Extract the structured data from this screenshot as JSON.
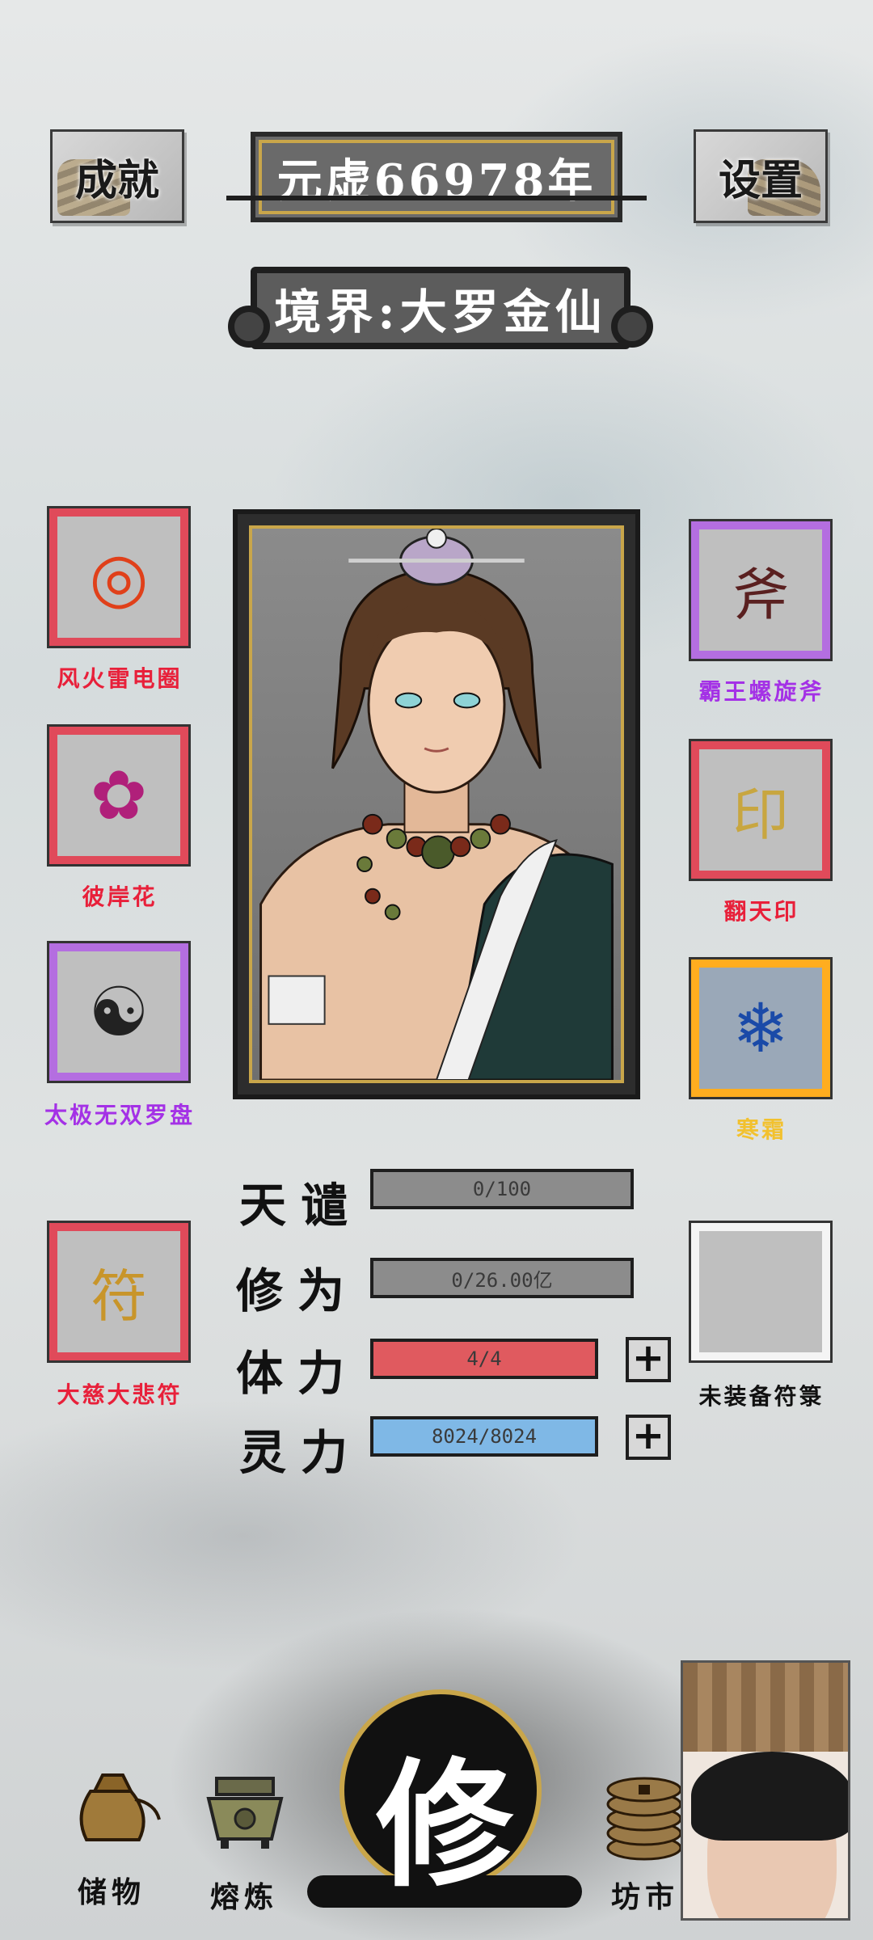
{
  "header": {
    "achievements_label": "成就",
    "year_label": "元虚66978年",
    "settings_label": "设置",
    "realm_label": "境界:大罗金仙"
  },
  "equipment": {
    "left": [
      {
        "name": "风火雷电圈",
        "rarity_color": "#e04a5a",
        "label_color": "#e8203a",
        "icon": "fire-ring-icon",
        "glyph": "◎"
      },
      {
        "name": "彼岸花",
        "rarity_color": "#e04a5a",
        "label_color": "#e8203a",
        "icon": "spider-lily-icon",
        "glyph": "✿"
      },
      {
        "name": "太极无双罗盘",
        "rarity_color": "#b46ee0",
        "label_color": "#a431e6",
        "icon": "bagua-compass-icon",
        "glyph": "☯"
      },
      {
        "name": "大慈大悲符",
        "rarity_color": "#e04a5a",
        "label_color": "#e8203a",
        "icon": "talisman-icon",
        "glyph": "符"
      }
    ],
    "right": [
      {
        "name": "霸王螺旋斧",
        "rarity_color": "#b46ee0",
        "label_color": "#a431e6",
        "icon": "axe-icon",
        "glyph": "斧"
      },
      {
        "name": "翻天印",
        "rarity_color": "#e04a5a",
        "label_color": "#e8203a",
        "icon": "dragon-seal-icon",
        "glyph": "印"
      },
      {
        "name": "寒霜",
        "rarity_color": "#ffad1f",
        "label_color": "#f2c12e",
        "icon": "frost-orb-icon",
        "glyph": "❄"
      },
      {
        "name": "未装备符箓",
        "rarity_color": "#f4f4f4",
        "label_color": "#111111",
        "icon": "empty-slot-icon",
        "glyph": ""
      }
    ]
  },
  "stats": {
    "tianqian": {
      "label": "天谴",
      "value": "0/100",
      "fill_fraction": 0.0,
      "color": "#8c8c8c"
    },
    "xiuwei": {
      "label": "修为",
      "value": "0/26.00亿",
      "fill_fraction": 0.0,
      "color": "#8c8c8c"
    },
    "tili": {
      "label": "体力",
      "value": "4/4",
      "fill_fraction": 1.0,
      "color": "#e05a5f"
    },
    "lingli": {
      "label": "灵力",
      "value": "8024/8024",
      "fill_fraction": 1.0,
      "color": "#7fb8e6"
    }
  },
  "nav": {
    "storage_label": "储物",
    "smelt_label": "熔炼",
    "cultivate_label": "修",
    "market_label": "坊市"
  }
}
